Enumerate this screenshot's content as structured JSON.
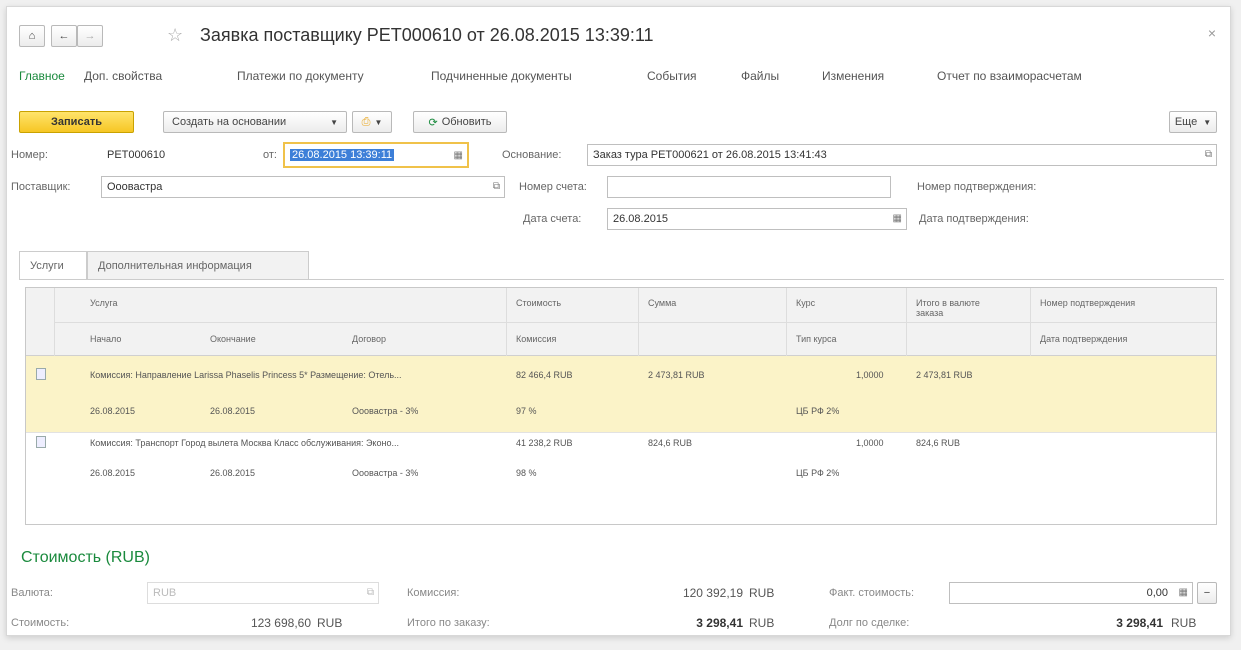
{
  "window": {
    "title": "Заявка поставщику PET000610 от 26.08.2015 13:39:11",
    "close": "×"
  },
  "nav": [
    "Главное",
    "Доп. свойства",
    "Платежи по документу",
    "Подчиненные документы",
    "События",
    "Файлы",
    "Изменения",
    "Отчет по взаиморасчетам"
  ],
  "toolbar": {
    "save": "Записать",
    "create_based": "Создать на основании",
    "refresh": "Обновить",
    "more": "Еще"
  },
  "header": {
    "number_label": "Номер:",
    "number_value": "PET000610",
    "from_label": "от:",
    "date_value": "26.08.2015 13:39:11",
    "basis_label": "Основание:",
    "basis_value": "Заказ тура PET000621 от 26.08.2015 13:41:43",
    "supplier_label": "Поставщик:",
    "supplier_value": "Ооовастра",
    "invoice_no_label": "Номер счета:",
    "invoice_no_value": "",
    "confirm_no_label": "Номер подтверждения:",
    "invoice_date_label": "Дата счета:",
    "invoice_date_value": "26.08.2015",
    "confirm_date_label": "Дата подтверждения:"
  },
  "tabs": [
    "Услуги",
    "Дополнительная информация"
  ],
  "grid": {
    "head_row1": [
      "Услуга",
      "Стоимость",
      "Сумма",
      "Курс",
      "Итого в валюте заказа",
      "Номер подтверждения"
    ],
    "head_row2": [
      "Начало",
      "Окончание",
      "Договор",
      "Комиссия",
      "Тип курса",
      "Дата подтверждения"
    ],
    "rows": [
      {
        "service": "Комиссия: Направление Larissa Phaselis Princess 5* Размещение: Отель...",
        "cost": "82 466,4 RUB",
        "sum": "2 473,81 RUB",
        "rate": "1,0000",
        "total": "2 473,81 RUB",
        "start": "26.08.2015",
        "end": "26.08.2015",
        "contract": "Ооовастра - 3%",
        "commission": "97 %",
        "rate_type": "ЦБ РФ 2%"
      },
      {
        "service": "Комиссия: Транспорт Город вылета Москва Класс обслуживания: Эконо...",
        "cost": "41 238,2 RUB",
        "sum": "824,6 RUB",
        "rate": "1,0000",
        "total": "824,6 RUB",
        "start": "26.08.2015",
        "end": "26.08.2015",
        "contract": "Ооовастра - 3%",
        "commission": "98 %",
        "rate_type": "ЦБ РФ 2%"
      }
    ]
  },
  "footer": {
    "section_title": "Стоимость (RUB)",
    "currency_label": "Валюта:",
    "currency_value": "RUB",
    "cost_label": "Стоимость:",
    "cost_value": "123 698,60",
    "cost_cur": "RUB",
    "commission_label": "Комиссия:",
    "commission_value": "120 392,19",
    "commission_cur": "RUB",
    "order_total_label": "Итого по заказу:",
    "order_total_value": "3 298,41",
    "order_total_cur": "RUB",
    "actual_cost_label": "Факт. стоимость:",
    "actual_cost_value": "0,00",
    "debt_label": "Долг по сделке:",
    "debt_value": "3 298,41",
    "debt_cur": "RUB"
  }
}
